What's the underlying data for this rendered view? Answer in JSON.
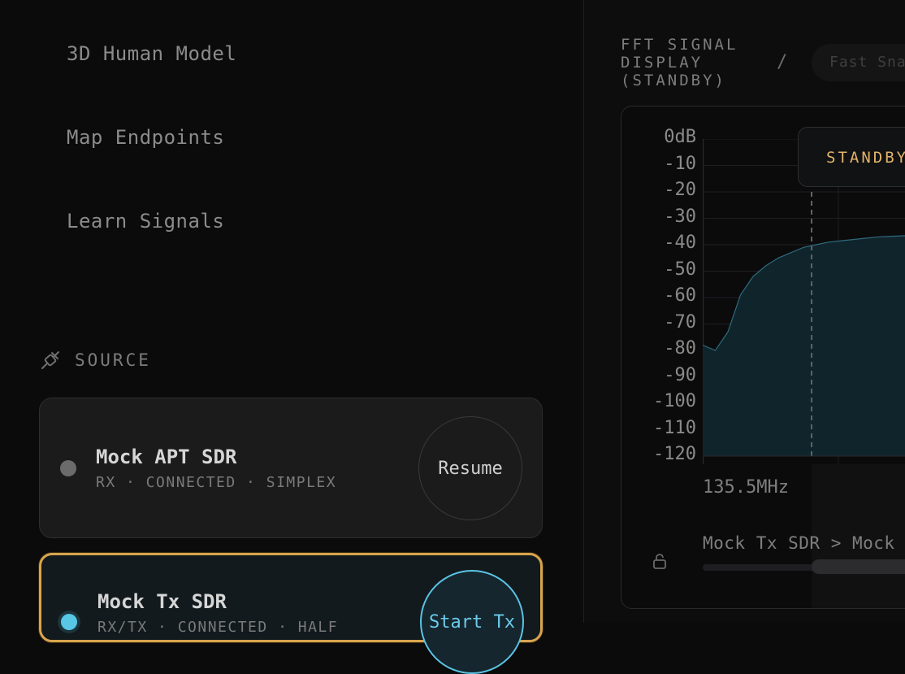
{
  "nav": {
    "items": [
      "3D Human Model",
      "Map Endpoints",
      "Learn Signals"
    ]
  },
  "source": {
    "header": "SOURCE",
    "icon": "plug-icon",
    "devices": [
      {
        "name": "Mock APT SDR",
        "status": "RX · CONNECTED · SIMPLEX",
        "action": "Resume",
        "selected": false,
        "dot_color": "#6b6b6b"
      },
      {
        "name": "Mock Tx SDR",
        "status": "RX/TX · CONNECTED · HALF",
        "action": "Start Tx",
        "selected": true,
        "dot_color": "#58c7e6"
      }
    ]
  },
  "fft": {
    "title": "FFT SIGNAL DISPLAY (STANDBY)",
    "separator": "/",
    "preset": "Fast Snap",
    "tooltip": "STANDBY",
    "route": "Mock Tx SDR > Mock",
    "lock_icon": "lock-icon"
  },
  "colors": {
    "accent_selected": "#d8a44e",
    "accent_tx": "#58c7e6",
    "tooltip_text": "#e3b46a",
    "spectrum_fill": "#11262d"
  },
  "chart_data": {
    "type": "area",
    "title": "",
    "xlabel": "",
    "ylabel": "",
    "y_ticks": [
      "0dB",
      "-10",
      "-20",
      "-30",
      "-40",
      "-50",
      "-60",
      "-70",
      "-80",
      "-90",
      "-100",
      "-110",
      "-120"
    ],
    "x_ticks": [
      "135.5MHz"
    ],
    "ylim": [
      -120,
      0
    ],
    "grid": true,
    "marker_line": true,
    "series": [
      {
        "x": [
          0,
          5,
          10,
          15,
          20,
          25,
          30,
          35,
          40,
          45,
          50,
          55,
          60,
          65,
          70,
          75,
          80,
          85,
          90,
          95,
          100
        ],
        "values": [
          -78,
          -80,
          -73,
          -59,
          -52,
          -48,
          -45,
          -43,
          -41,
          -40,
          -39,
          -38.5,
          -38,
          -37.5,
          -37,
          -36.8,
          -36.6,
          -36.5,
          -36.4,
          -36.3,
          -36.3
        ]
      }
    ]
  }
}
